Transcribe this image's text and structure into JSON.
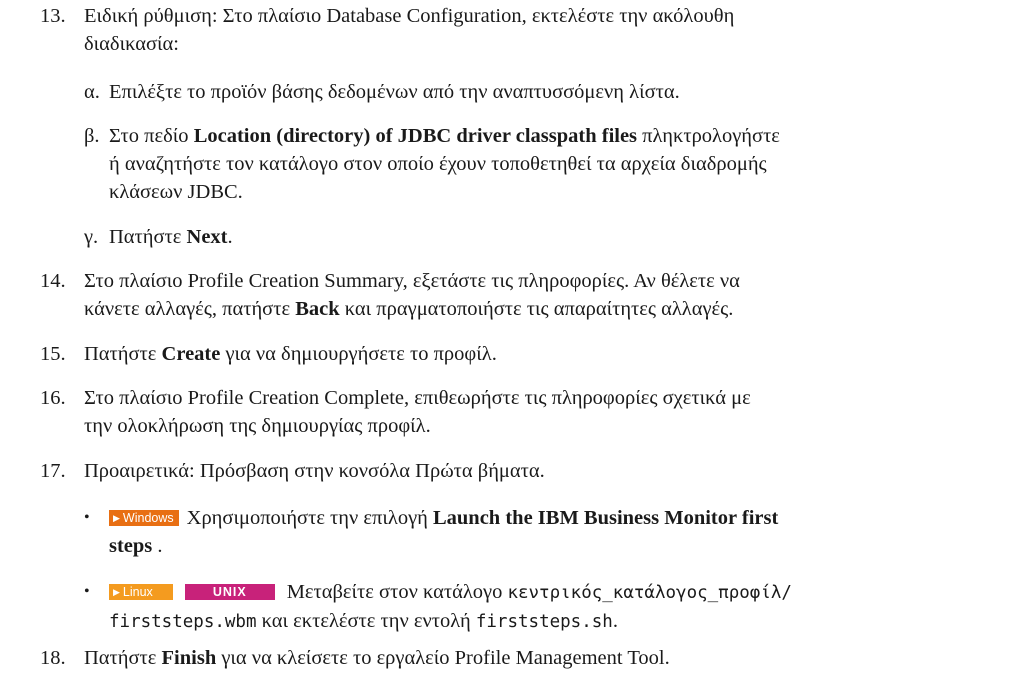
{
  "steps": [
    {
      "num": "13.",
      "text_a": "Ειδική ρύθμιση: Στο πλαίσιο Database Configuration, εκτελέστε την ακόλουθη",
      "text_b": "διαδικασία:"
    },
    {
      "num": "14.",
      "text_a": "Στο πλαίσιο Profile Creation Summary, εξετάστε τις πληροφορίες. Αν θέλετε να",
      "text_b_pre": "κάνετε αλλαγές, πατήστε ",
      "text_b_bold": "Back",
      "text_b_post": " και πραγματοποιήστε τις απαραίτητες αλλαγές."
    },
    {
      "num": "15.",
      "pre": "Πατήστε ",
      "bold": "Create",
      "post": " για να δημιουργήσετε το προφίλ."
    },
    {
      "num": "16.",
      "text_a": "Στο πλαίσιο Profile Creation Complete, επιθεωρήστε τις πληροφορίες σχετικά με",
      "text_b": "την ολοκλήρωση της δημιουργίας προφίλ."
    },
    {
      "num": "17.",
      "text": "Προαιρετικά: Πρόσβαση στην κονσόλα Πρώτα βήματα."
    },
    {
      "num": "18.",
      "pre": "Πατήστε ",
      "bold": "Finish",
      "post": " για να κλείσετε το εργαλείο Profile Management Tool."
    }
  ],
  "substeps": [
    {
      "label": "α.",
      "text": "Επιλέξτε το προϊόν βάσης δεδομένων από την αναπτυσσόμενη λίστα."
    },
    {
      "label": "β.",
      "pre": "Στο πεδίο ",
      "bold": "Location (directory) of JDBC driver classpath files",
      "post": " πληκτρολογήστε",
      "line2": "ή αναζητήστε τον κατάλογο στον οποίο έχουν τοποθετηθεί τα αρχεία διαδρομής",
      "line3": "κλάσεων JDBC."
    },
    {
      "label": "γ.",
      "pre": "Πατήστε ",
      "bold": "Next",
      "post": "."
    }
  ],
  "bullets": {
    "windows": {
      "badge": "Windows",
      "pre": "Χρησιμοποιήστε την επιλογή ",
      "bold": "Launch the IBM Business Monitor first",
      "bold2": "steps",
      "post2": " ."
    },
    "linux": {
      "badge_linux": "Linux",
      "badge_unix": "UNIX",
      "pre": "Μεταβείτε στον κατάλογο ",
      "mono1": "κεντρικός_κατάλογος_προφίλ/",
      "mono2": "firststeps.wbm",
      "mid": " και εκτελέστε την εντολή ",
      "mono3": "firststeps.sh",
      "post": "."
    }
  }
}
